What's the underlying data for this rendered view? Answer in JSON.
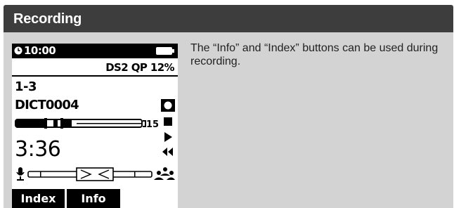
{
  "header": {
    "title": "Recording"
  },
  "description": "The “Info” and “Index” buttons can be used during recording.",
  "device": {
    "time": "10:00",
    "format": "DS2 QP 12%",
    "position": "1-3",
    "filename": "DICT0004",
    "index_count": "15",
    "elapsed": "3:36",
    "buttons": {
      "index": "Index",
      "info": "Info"
    },
    "icons": [
      "clock-icon",
      "battery-icon",
      "record-icon",
      "stop-icon",
      "play-icon",
      "rewind-icon",
      "microphone-icon",
      "conference-icon"
    ]
  }
}
